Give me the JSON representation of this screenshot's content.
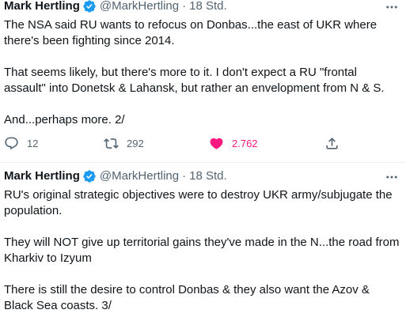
{
  "colors": {
    "text": "#0f1419",
    "secondary": "#536471",
    "verified": "#1d9bf0",
    "like": "#f91880"
  },
  "tweets": [
    {
      "name": "Mark Hertling",
      "handle": "@MarkHertling",
      "dot": "·",
      "time": "18 Std.",
      "verified_icon": "verified-badge-icon",
      "paragraphs": [
        "The NSA said RU wants to refocus on Donbas...the east of UKR where there's been fighting since 2014.",
        "That seems likely, but there's more to it.  I don't expect a RU \"frontal assault\" into Donetsk & Lahansk, but rather an envelopment from N & S.",
        "And...perhaps more.  2/"
      ],
      "actions": {
        "replies": "12",
        "retweets": "292",
        "likes": "2.762",
        "liked": true
      }
    },
    {
      "name": "Mark Hertling",
      "handle": "@MarkHertling",
      "dot": "·",
      "time": "18 Std.",
      "verified_icon": "verified-badge-icon",
      "paragraphs": [
        "RU's original strategic objectives were to destroy UKR army/subjugate the population.",
        "They will NOT give up territorial gains they've made in the N...the road from Kharkiv to Izyum",
        "There is still the desire to control Donbas & they also want the Azov & Black Sea coasts. 3/"
      ]
    }
  ]
}
